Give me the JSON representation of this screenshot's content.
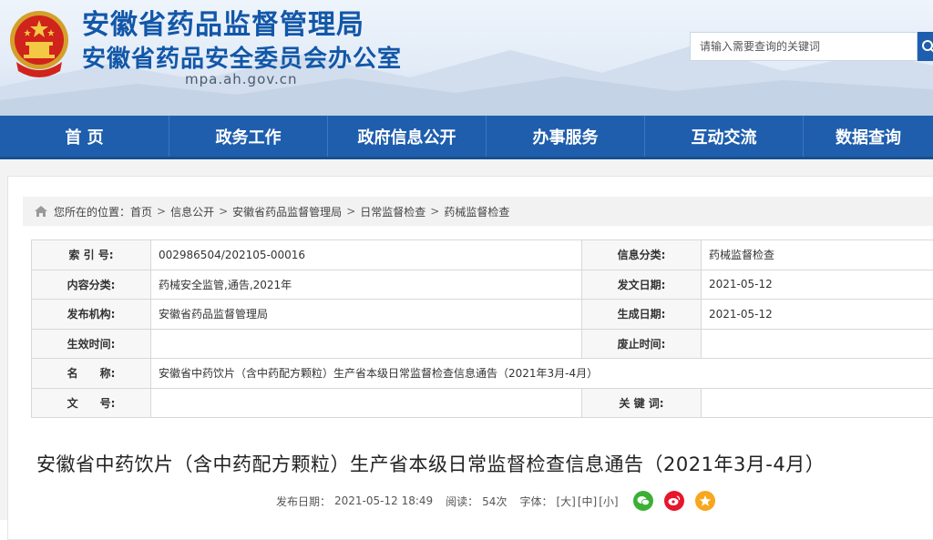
{
  "header": {
    "title_line1": "安徽省药品监督管理局",
    "title_line2": "安徽省药品安全委员会办公室",
    "domain": "mpa.ah.gov.cn",
    "search_placeholder": "请输入需要查询的关键词"
  },
  "nav": {
    "items": [
      {
        "label": "首 页"
      },
      {
        "label": "政务工作"
      },
      {
        "label": "政府信息公开"
      },
      {
        "label": "办事服务"
      },
      {
        "label": "互动交流"
      },
      {
        "label": "数据查询"
      }
    ]
  },
  "breadcrumb": {
    "prefix": "您所在的位置：",
    "items": [
      "首页",
      "信息公开",
      "安徽省药品监督管理局",
      "日常监督检查",
      "药械监督检查"
    ],
    "separator": ">"
  },
  "meta_table": {
    "index_label": "索 引 号:",
    "index_value": "002986504/202105-00016",
    "category_label": "信息分类:",
    "category_value": "药械监督检查",
    "content_label": "内容分类:",
    "content_value": "药械安全监管,通告,2021年",
    "issue_date_label": "发文日期:",
    "issue_date_value": "2021-05-12",
    "publisher_label": "发布机构:",
    "publisher_value": "安徽省药品监督管理局",
    "gen_date_label": "生成日期:",
    "gen_date_value": "2021-05-12",
    "effective_label": "生效时间:",
    "effective_value": "",
    "expire_label": "废止时间:",
    "expire_value": "",
    "name_label": "名　　称:",
    "name_value": "安徽省中药饮片（含中药配方颗粒）生产省本级日常监督检查信息通告（2021年3月-4月）",
    "docno_label": "文　　号:",
    "docno_value": "",
    "keywords_label": "关 键 词:",
    "keywords_value": ""
  },
  "article": {
    "title": "安徽省中药饮片（含中药配方颗粒）生产省本级日常监督检查信息通告（2021年3月-4月）",
    "publish_label": "发布日期：",
    "publish_value": "2021-05-12 18:49",
    "views_label": "阅读：",
    "views_value": "54次",
    "font_label": "字体：",
    "font_large": "[大]",
    "font_medium": "[中]",
    "font_small": "[小]"
  },
  "icons": {
    "home": "home-icon",
    "search": "search-icon",
    "wechat": "wechat-icon",
    "weibo": "weibo-icon",
    "favorite": "star-icon"
  },
  "colors": {
    "brand_blue": "#1f5ead",
    "title_blue": "#1257a8",
    "wechat_green": "#3cb034",
    "weibo_red": "#e6162d",
    "star_orange": "#f7a71d"
  }
}
